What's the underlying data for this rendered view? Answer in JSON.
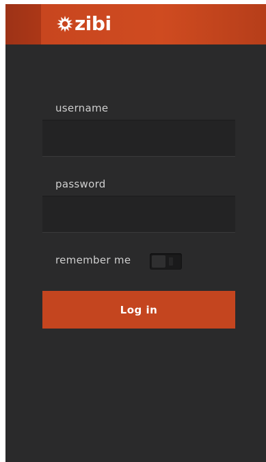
{
  "header": {
    "brand": "zibi",
    "logo_icon": "sunburst-logo-icon",
    "accent_color": "#c4451f"
  },
  "form": {
    "username_label": "username",
    "username_value": "",
    "password_label": "password",
    "password_value": "",
    "remember_label": "remember me",
    "remember_checked": false,
    "login_label": "Log in"
  },
  "colors": {
    "background": "#2a2a2b",
    "input_background": "#232324",
    "label_text": "#cfcfcf"
  }
}
